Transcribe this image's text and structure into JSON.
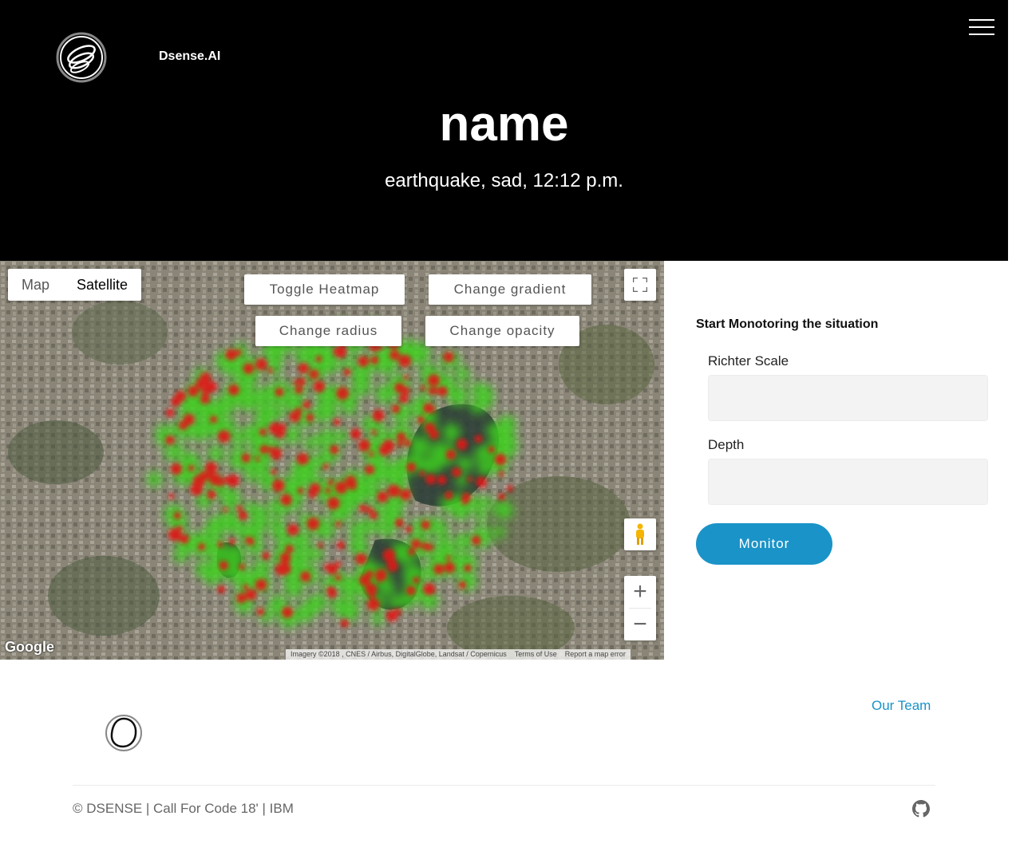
{
  "header": {
    "brand": "Dsense.AI",
    "title": "name",
    "subtitle": "earthquake, sad, 12:12 p.m."
  },
  "map": {
    "type_map": "Map",
    "type_satellite": "Satellite",
    "active_type": "Satellite",
    "buttons": {
      "toggle_heatmap": "Toggle Heatmap",
      "change_gradient": "Change gradient",
      "change_radius": "Change radius",
      "change_opacity": "Change opacity"
    },
    "zoom_in": "+",
    "zoom_out": "−",
    "google_logo": "Google",
    "attribution": {
      "imagery": "Imagery ©2018 , CNES / Airbus, DigitalGlobe, Landsat / Copernicus",
      "terms": "Terms of Use",
      "report": "Report a map error"
    }
  },
  "form": {
    "title": "Start Monotoring the situation",
    "richter_label": "Richter Scale",
    "richter_value": "",
    "depth_label": "Depth",
    "depth_value": "",
    "submit": "Monitor"
  },
  "footer": {
    "our_team": "Our Team",
    "copyright": "© DSENSE | Call For Code 18' | IBM"
  },
  "colors": {
    "accent": "#1a93c8",
    "header_bg": "#000000",
    "heat_low": "#3cd21e",
    "heat_high": "#e11414"
  },
  "icons": [
    "logo-icon",
    "hamburger-menu-icon",
    "fullscreen-icon",
    "pegman-icon",
    "footer-logo-icon",
    "github-icon"
  ]
}
